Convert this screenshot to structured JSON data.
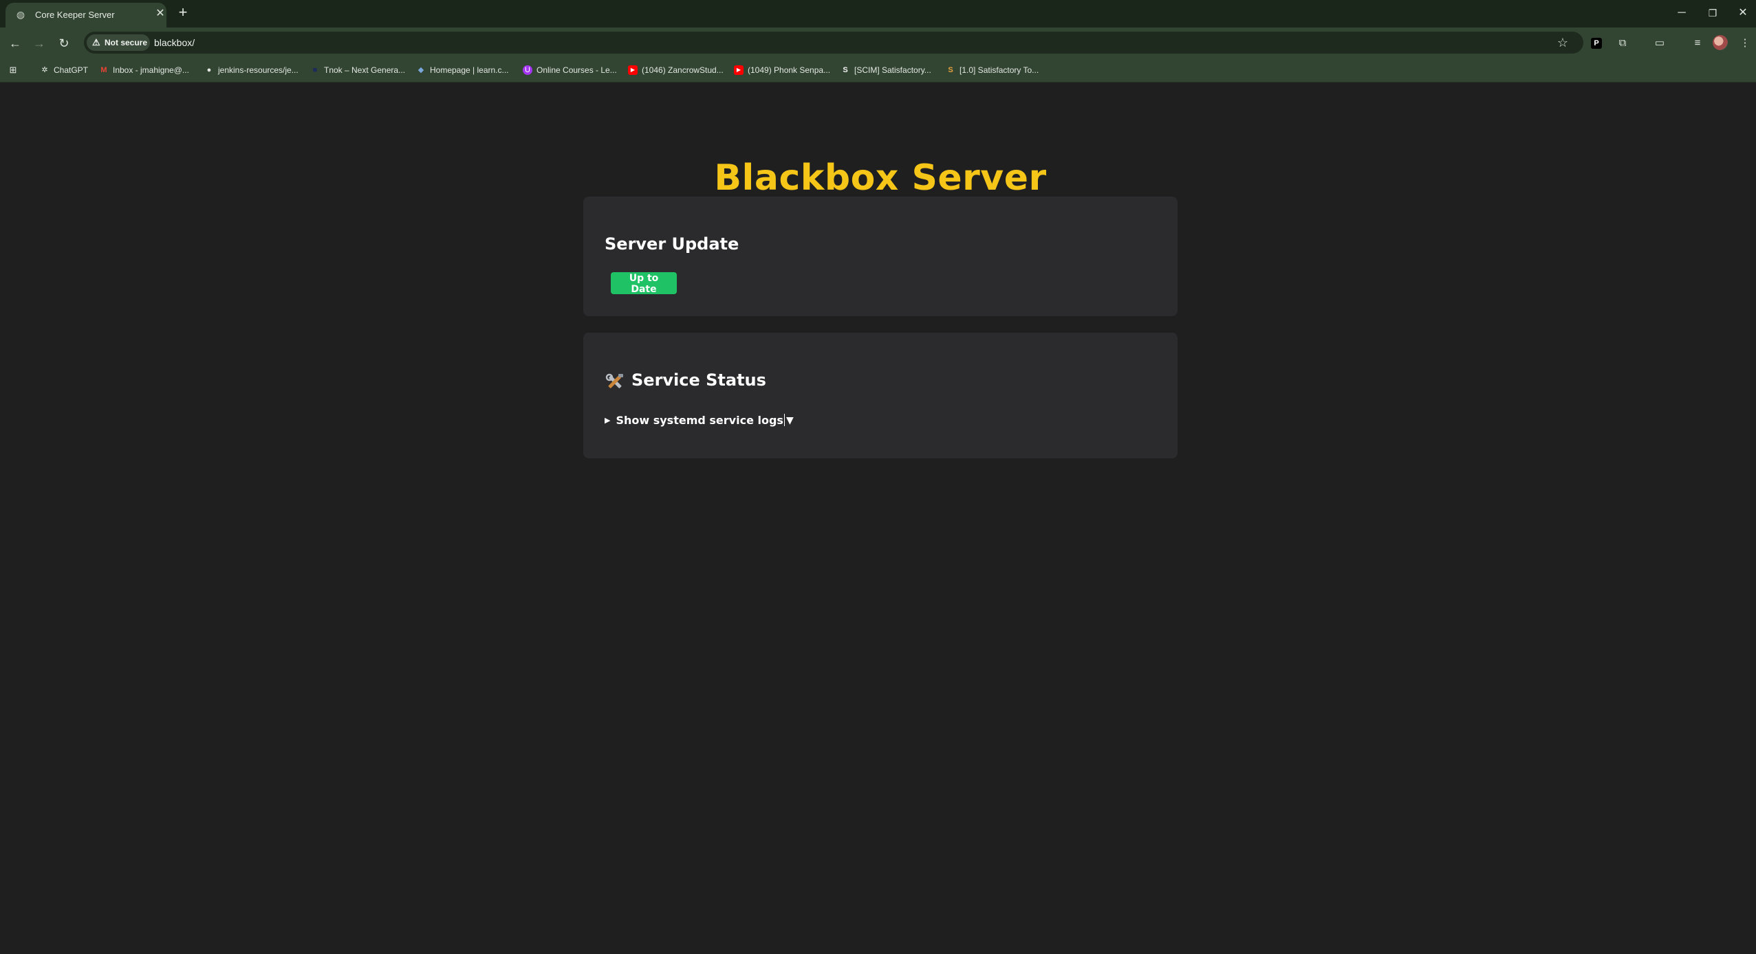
{
  "browser": {
    "tab": {
      "title": "Core Keeper Server",
      "close": "✕"
    },
    "new_tab": "+",
    "window_controls": {
      "minimize": "─",
      "restore": "❐",
      "close": "✕"
    },
    "security_label": "Not secure",
    "url": "blackbox/",
    "bookmarks": [
      {
        "label": "ChatGPT",
        "icon": "chatgpt-icon"
      },
      {
        "label": "Inbox - jmahigne@...",
        "icon": "gmail-icon"
      },
      {
        "label": "jenkins-resources/je...",
        "icon": "github-icon"
      },
      {
        "label": "Tnok – Next Genera...",
        "icon": "tnok-icon"
      },
      {
        "label": "Homepage | learn.c...",
        "icon": "learn-icon"
      },
      {
        "label": "Online Courses - Le...",
        "icon": "udemy-icon"
      },
      {
        "label": "(1046) ZancrowStud...",
        "icon": "youtube-icon"
      },
      {
        "label": "(1049) Phonk Senpa...",
        "icon": "youtube-icon"
      },
      {
        "label": "[SCIM] Satisfactory...",
        "icon": "satisfactory-icon"
      },
      {
        "label": "[1.0] Satisfactory To...",
        "icon": "satisfactory-icon"
      }
    ]
  },
  "page": {
    "title": "Blackbox Server",
    "server_update": {
      "heading": "Server Update",
      "status_button": "Up to Date",
      "status_color": "#1fc264"
    },
    "service_status": {
      "heading": "Service Status",
      "icon": "tools-icon",
      "logs_toggle": "Show systemd service logs",
      "logs_arrow": "▼"
    },
    "accent_color": "#f5c517"
  }
}
